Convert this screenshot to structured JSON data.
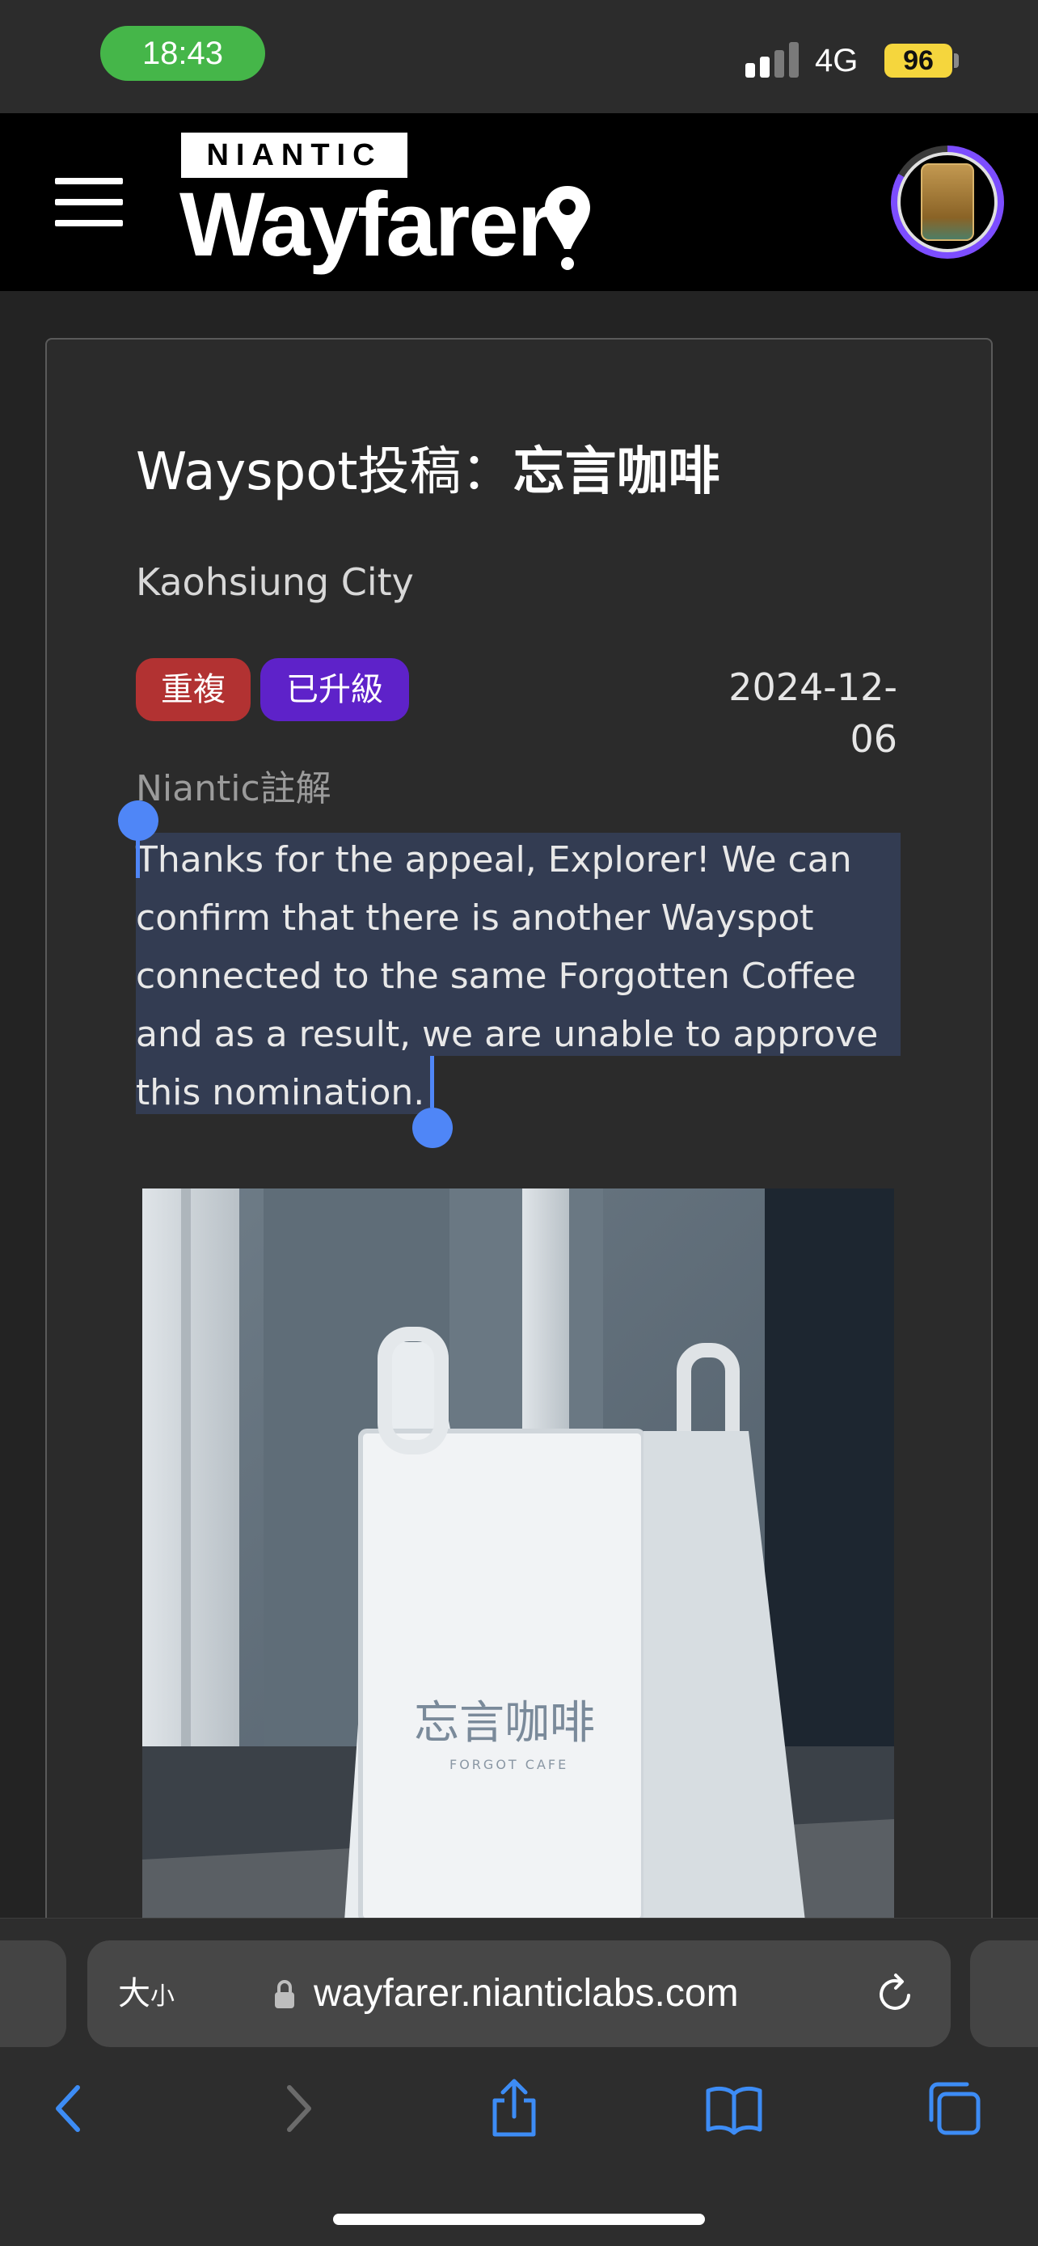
{
  "status_bar": {
    "time": "18:43",
    "network": "4G",
    "battery": "96"
  },
  "app_header": {
    "brand_top": "NIANTIC",
    "brand_main": "Wayfarer"
  },
  "submission": {
    "title_prefix": "Wayspot投稿：",
    "title_name": "忘言咖啡",
    "city": "Kaohsiung City",
    "badges": {
      "duplicate": "重複",
      "upgraded": "已升級"
    },
    "date": "2024-12-06",
    "note_label": "Niantic註解",
    "note_text": "Thanks for the appeal, Explorer! We can confirm that there is another Wayspot connected to the same Forgotten Coffee and as a result, we are unable to approve this nomination.",
    "photo_sign_text": "忘言咖啡",
    "photo_sign_subtext": "FORGOT CAFE"
  },
  "browser": {
    "text_size_large": "大",
    "text_size_small": "小",
    "url": "wayfarer.nianticlabs.com"
  },
  "colors": {
    "duplicate_badge": "#b23232",
    "upgraded_badge": "#5e22c9",
    "selection_handle": "#4f86f7",
    "time_pill": "#45b649",
    "battery": "#f5d63d"
  }
}
